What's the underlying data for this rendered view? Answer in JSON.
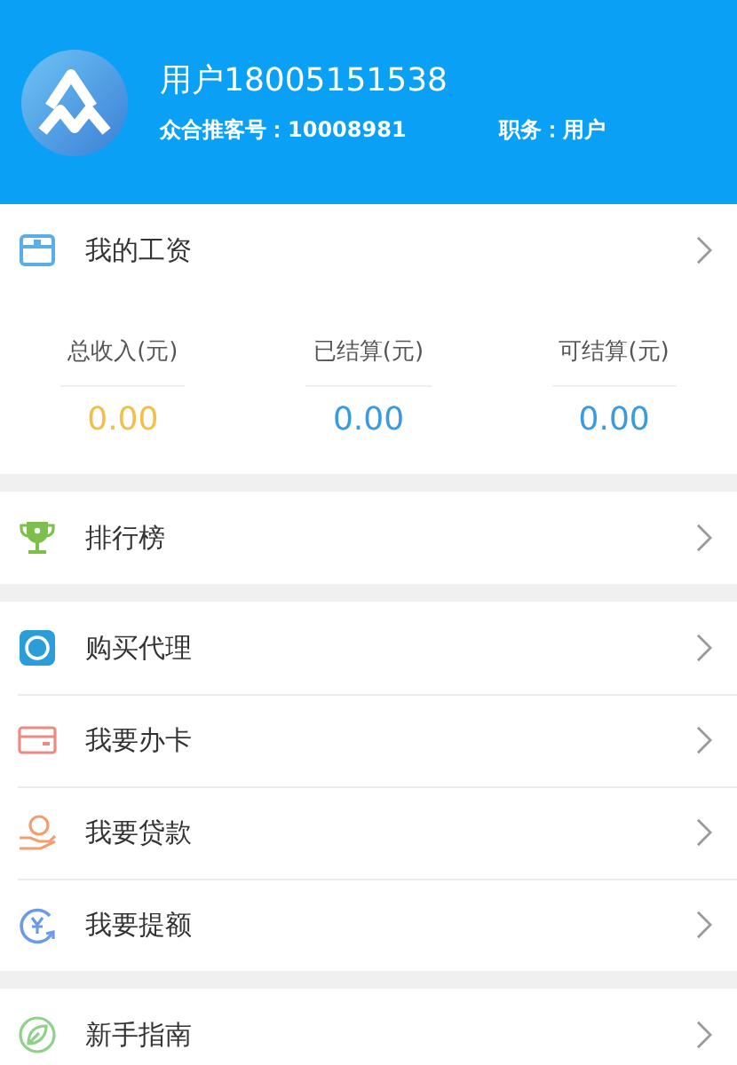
{
  "profile": {
    "name": "用户18005151538",
    "referral": "众合推客号：10008981",
    "role": "职务：用户"
  },
  "wages": {
    "label": "我的工资"
  },
  "stats": [
    {
      "label": "总收入(元)",
      "value": "0.00",
      "color": "#f2c04a"
    },
    {
      "label": "已结算(元)",
      "value": "0.00",
      "color": "#3b9be0"
    },
    {
      "label": "可结算(元)",
      "value": "0.00",
      "color": "#3b9be0"
    }
  ],
  "groups": [
    [
      {
        "label": "排行榜",
        "kind": "trophy"
      }
    ],
    [
      {
        "label": "购买代理",
        "kind": "agent"
      },
      {
        "label": "我要办卡",
        "kind": "card"
      },
      {
        "label": "我要贷款",
        "kind": "loan"
      },
      {
        "label": "我要提额",
        "kind": "raise"
      }
    ],
    [
      {
        "label": "新手指南",
        "kind": "guide"
      }
    ]
  ]
}
